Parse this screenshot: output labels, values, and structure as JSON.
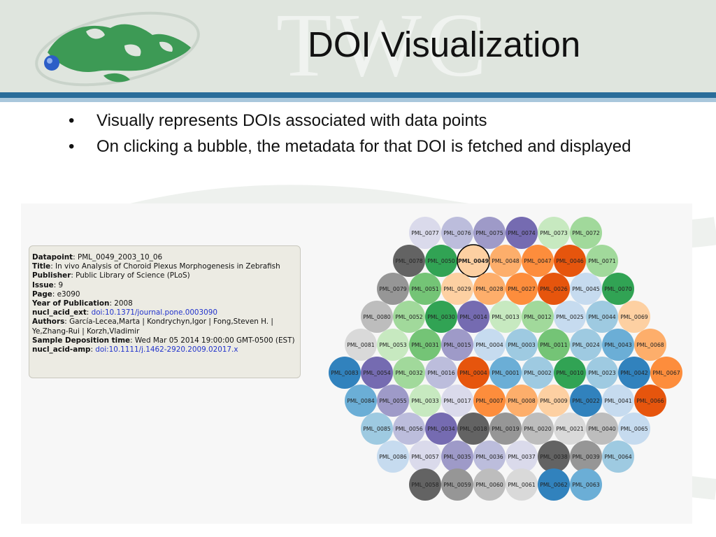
{
  "slide": {
    "title": "DOI Visualization",
    "watermark": "TWC",
    "bullets": [
      "Visually represents DOIs associated with data points",
      "On clicking a bubble, the metadata for that DOI is fetched and displayed"
    ]
  },
  "metadata_panel": {
    "datapoint_key": "Datapoint",
    "datapoint": "PML_0049_2003_10_06",
    "title_key": "Title",
    "title": "In vivo Analysis of Choroid Plexus Morphogenesis in Zebrafish",
    "publisher_key": "Publisher",
    "publisher": "Public Library of Science (PLoS)",
    "issue_key": "Issue",
    "issue": "9",
    "page_key": "Page",
    "page": "e3090",
    "year_key": "Year of Publication",
    "year": "2008",
    "ext_key": "nucl_acid_ext",
    "ext": "doi:10.1371/journal.pone.0003090",
    "authors_key": "Authors",
    "authors": "García-Lecea,Marta | Kondrychyn,Igor | Fong,Steven H. | Ye,Zhang-Rui | Korzh,Vladimir",
    "deposition_key": "Sample Deposition time",
    "deposition": "Wed Mar 05 2014 19:00:00 GMT-0500 (EST)",
    "amp_key": "nucl_acid-amp",
    "amp": "doi:10.1111/j.1462-2920.2009.02017.x"
  },
  "bubbles": {
    "selected": "PML_0049",
    "palette": {
      "gray_dark": "#636363",
      "gray_mid": "#969696",
      "gray_light": "#bdbdbd",
      "gray_pale": "#d9d9d9",
      "green_dark": "#31a354",
      "green_mid": "#74c476",
      "green_light": "#a1d99b",
      "green_pale": "#c7e9c0",
      "orange_dark": "#e6550d",
      "orange_mid": "#fd8d3c",
      "orange_light": "#fdae6b",
      "orange_pale": "#fdd0a2",
      "blue_dark": "#3182bd",
      "blue_mid": "#6baed6",
      "blue_light": "#9ecae1",
      "blue_pale": "#c6dbef",
      "purple_dark": "#756bb1",
      "purple_mid": "#9e9ac8",
      "purple_light": "#bcbddc",
      "purple_pale": "#dadaeb"
    },
    "rows": [
      [
        [
          "PML_0077",
          "purple_pale"
        ],
        [
          "PML_0076",
          "purple_light"
        ],
        [
          "PML_0075",
          "purple_mid"
        ],
        [
          "PML_0074",
          "purple_dark"
        ],
        [
          "PML_0073",
          "green_pale"
        ],
        [
          "PML_0072",
          "green_light"
        ]
      ],
      [
        [
          "PML_0078",
          "gray_dark"
        ],
        [
          "PML_0050",
          "green_dark"
        ],
        [
          "PML_0049",
          "orange_pale"
        ],
        [
          "PML_0048",
          "orange_light"
        ],
        [
          "PML_0047",
          "orange_mid"
        ],
        [
          "PML_0046",
          "orange_dark"
        ],
        [
          "PML_0071",
          "green_light"
        ]
      ],
      [
        [
          "PML_0079",
          "gray_mid"
        ],
        [
          "PML_0051",
          "green_mid"
        ],
        [
          "PML_0029",
          "orange_pale"
        ],
        [
          "PML_0028",
          "orange_light"
        ],
        [
          "PML_0027",
          "orange_mid"
        ],
        [
          "PML_0026",
          "orange_dark"
        ],
        [
          "PML_0045",
          "blue_pale"
        ],
        [
          "PML_0070",
          "green_dark"
        ]
      ],
      [
        [
          "PML_0080",
          "gray_light"
        ],
        [
          "PML_0052",
          "green_light"
        ],
        [
          "PML_0030",
          "green_dark"
        ],
        [
          "PML_0014",
          "purple_dark"
        ],
        [
          "PML_0013",
          "green_pale"
        ],
        [
          "PML_0012",
          "green_light"
        ],
        [
          "PML_0025",
          "blue_pale"
        ],
        [
          "PML_0044",
          "blue_light"
        ],
        [
          "PML_0069",
          "orange_pale"
        ]
      ],
      [
        [
          "PML_0081",
          "gray_pale"
        ],
        [
          "PML_0053",
          "green_pale"
        ],
        [
          "PML_0031",
          "green_mid"
        ],
        [
          "PML_0015",
          "purple_mid"
        ],
        [
          "PML_0004",
          "blue_pale"
        ],
        [
          "PML_0003",
          "blue_light"
        ],
        [
          "PML_0011",
          "green_mid"
        ],
        [
          "PML_0024",
          "blue_light"
        ],
        [
          "PML_0043",
          "blue_mid"
        ],
        [
          "PML_0068",
          "orange_light"
        ]
      ],
      [
        [
          "PML_0083",
          "blue_dark"
        ],
        [
          "PML_0054",
          "purple_dark"
        ],
        [
          "PML_0032",
          "green_light"
        ],
        [
          "PML_0016",
          "purple_light"
        ],
        [
          "PML_0004",
          "orange_dark"
        ],
        [
          "PML_0001",
          "blue_mid"
        ],
        [
          "PML_0002",
          "blue_light"
        ],
        [
          "PML_0010",
          "green_dark"
        ],
        [
          "PML_0023",
          "blue_light"
        ],
        [
          "PML_0042",
          "blue_dark"
        ],
        [
          "PML_0067",
          "orange_mid"
        ]
      ],
      [
        [
          "PML_0084",
          "blue_mid"
        ],
        [
          "PML_0055",
          "purple_mid"
        ],
        [
          "PML_0033",
          "green_pale"
        ],
        [
          "PML_0017",
          "purple_pale"
        ],
        [
          "PML_0007",
          "orange_mid"
        ],
        [
          "PML_0008",
          "orange_light"
        ],
        [
          "PML_0009",
          "orange_pale"
        ],
        [
          "PML_0022",
          "blue_dark"
        ],
        [
          "PML_0041",
          "blue_pale"
        ],
        [
          "PML_0066",
          "orange_dark"
        ]
      ],
      [
        [
          "PML_0085",
          "blue_light"
        ],
        [
          "PML_0056",
          "purple_light"
        ],
        [
          "PML_0034",
          "purple_dark"
        ],
        [
          "PML_0018",
          "gray_dark"
        ],
        [
          "PML_0019",
          "gray_mid"
        ],
        [
          "PML_0020",
          "gray_light"
        ],
        [
          "PML_0021",
          "gray_pale"
        ],
        [
          "PML_0040",
          "gray_light"
        ],
        [
          "PML_0065",
          "blue_pale"
        ]
      ],
      [
        [
          "PML_0086",
          "blue_pale"
        ],
        [
          "PML_0057",
          "purple_pale"
        ],
        [
          "PML_0035",
          "purple_mid"
        ],
        [
          "PML_0036",
          "purple_light"
        ],
        [
          "PML_0037",
          "purple_pale"
        ],
        [
          "PML_0038",
          "gray_dark"
        ],
        [
          "PML_0039",
          "gray_mid"
        ],
        [
          "PML_0064",
          "blue_light"
        ]
      ],
      [
        [
          "PML_0058",
          "gray_dark"
        ],
        [
          "PML_0059",
          "gray_mid"
        ],
        [
          "PML_0060",
          "gray_light"
        ],
        [
          "PML_0061",
          "gray_pale"
        ],
        [
          "PML_0062",
          "blue_dark"
        ],
        [
          "PML_0063",
          "blue_mid"
        ]
      ]
    ]
  }
}
